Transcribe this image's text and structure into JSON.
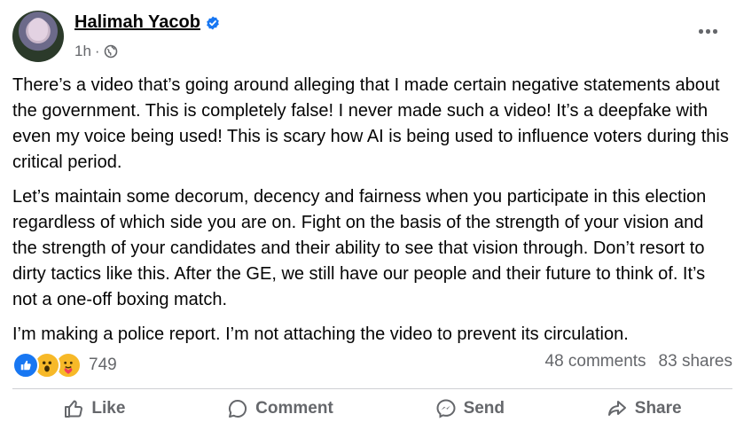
{
  "post": {
    "author": "Halimah Yacob",
    "time": "1h",
    "separator": "·",
    "verified_icon": "verified-badge-icon",
    "privacy_icon": "globe-icon",
    "more_icon": "more-options-icon",
    "paragraphs": [
      "There’s a video that’s going around alleging that I made certain negative statements about the government. This is completely false! I never made such a video! It’s a deepfake with even my voice being used! This is scary how AI is being used to influence voters during this critical period.",
      "Let’s maintain some decorum, decency and fairness when you participate in this election regardless of which side you are on. Fight on the basis of the strength of your vision and the strength of your candidates and their ability to see that vision through. Don’t resort to dirty tactics like this. After the GE, we still have our people and their future to think of. It’s not a one-off boxing match.",
      "I’m making a police report. I’m not attaching the video to prevent its circulation."
    ]
  },
  "engagement": {
    "reaction_icons": [
      "like-reaction-icon",
      "wow-reaction-icon",
      "care-reaction-icon"
    ],
    "reaction_count": "749",
    "comments": "48 comments",
    "shares": "83 shares"
  },
  "actions": {
    "like": "Like",
    "comment": "Comment",
    "send": "Send",
    "share": "Share"
  },
  "colors": {
    "text": "#050505",
    "secondary": "#65676b",
    "accent": "#1877f2",
    "divider": "#ced0d4"
  }
}
